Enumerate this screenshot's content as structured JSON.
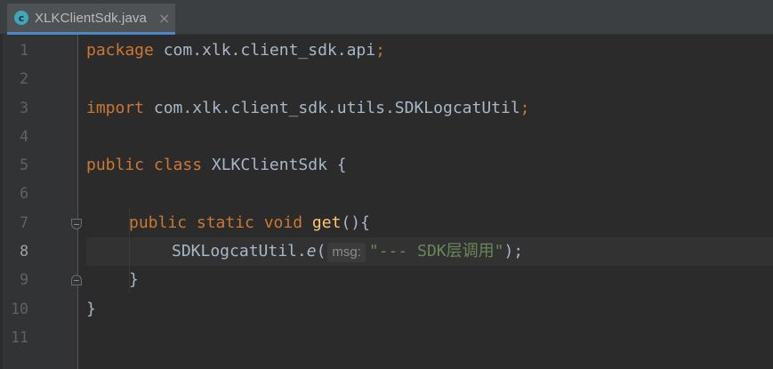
{
  "tab": {
    "icon_letter": "c",
    "icon_name": "java-class-icon",
    "filename": "XLKClientSdk.java",
    "close_glyph": "×"
  },
  "lines": [
    "1",
    "2",
    "3",
    "4",
    "5",
    "6",
    "7",
    "8",
    "9",
    "10",
    "11"
  ],
  "active_line": "8",
  "code": {
    "l1_kw": "package",
    "l1_rest": " com.xlk.client_sdk.api",
    "l1_semi": ";",
    "l3_kw": "import",
    "l3_rest": " com.xlk.client_sdk.utils.SDKLogcatUtil",
    "l3_semi": ";",
    "l5_kw": "public class",
    "l5_rest": " XLKClientSdk {",
    "l7_kw": "public static void",
    "l7_fn": "get",
    "l7_rest": "(){",
    "l8_obj": "SDKLogcatUtil.",
    "l8_method": "e",
    "l8_paren": "(",
    "l8_hint": "msg:",
    "l8_str": "\"--- SDK层调用\"",
    "l8_end": ");",
    "l9": "}",
    "l10": "}"
  },
  "colors": {
    "background": "#2b2b2b",
    "keyword": "#cc7832",
    "function": "#ffc66d",
    "string": "#6a8759",
    "text": "#a9b7c6"
  }
}
